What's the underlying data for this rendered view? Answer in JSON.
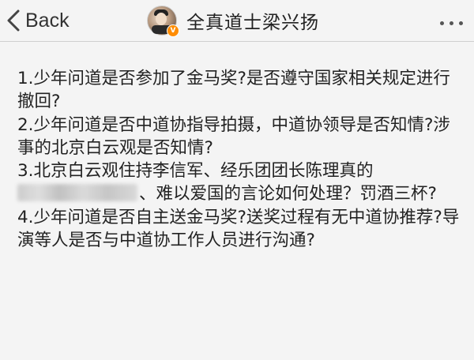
{
  "nav": {
    "back_label": "Back",
    "title": "全真道士梁兴扬",
    "verified_badge": "V",
    "icons": {
      "back": "chevron-left-icon",
      "more": "more-dots-icon"
    }
  },
  "post": {
    "para1": "1.少年问道是否参加了金马奖?是否遵守国家相关规定进行撤回?",
    "para2": "2.少年问道是否中道协指导拍摄，中道协领导是否知情?涉事的北京白云观是否知情?",
    "para3_before": "3.北京白云观住持李信军、经乐团团长陈理真的",
    "para3_after": "、难以爱国的言论如何处理？罚酒三杯?",
    "para4": "4.少年问道是否自主送金马奖?送奖过程有无中道协推荐?导演等人是否与中道协工作人员进行沟通?"
  }
}
